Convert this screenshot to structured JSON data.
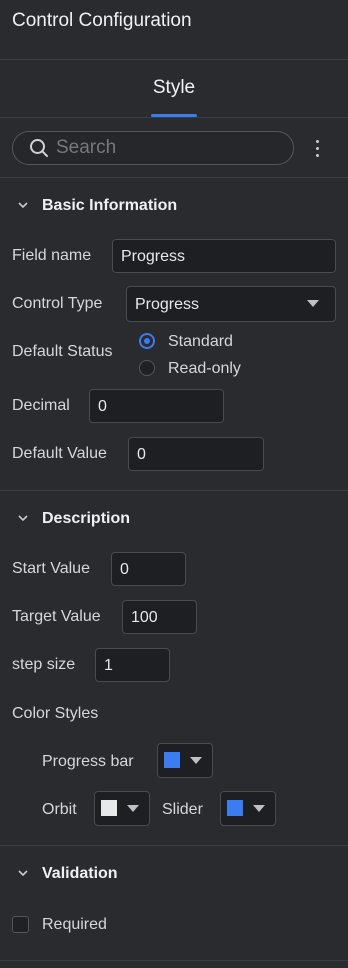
{
  "panel": {
    "title": "Control Configuration"
  },
  "tabs": [
    {
      "label": "Style",
      "active": true
    }
  ],
  "search": {
    "placeholder": "Search"
  },
  "icons": {
    "search": "search-icon",
    "more": "more-vertical-icon",
    "chevron": "chevron-down-icon",
    "dropdown": "caret-down-icon"
  },
  "colors": {
    "accent": "#3d7cf0",
    "progress_bar": "#3d7cf0",
    "orbit": "#e8e8e8",
    "slider": "#3d7cf0"
  },
  "basic": {
    "title": "Basic Information",
    "field_name_label": "Field name",
    "field_name_value": "Progress",
    "control_type_label": "Control Type",
    "control_type_value": "Progress",
    "default_status_label": "Default Status",
    "status_standard": "Standard",
    "status_readonly": "Read-only",
    "status_selected": "Standard",
    "decimal_label": "Decimal",
    "decimal_value": "0",
    "default_value_label": "Default Value",
    "default_value_value": "0"
  },
  "description": {
    "title": "Description",
    "start_label": "Start Value",
    "start_value": "0",
    "target_label": "Target Value",
    "target_value": "100",
    "step_label": "step size",
    "step_value": "1",
    "color_styles_label": "Color Styles",
    "progress_bar_label": "Progress bar",
    "orbit_label": "Orbit",
    "slider_label": "Slider"
  },
  "validation": {
    "title": "Validation",
    "required_label": "Required",
    "required_checked": false
  }
}
